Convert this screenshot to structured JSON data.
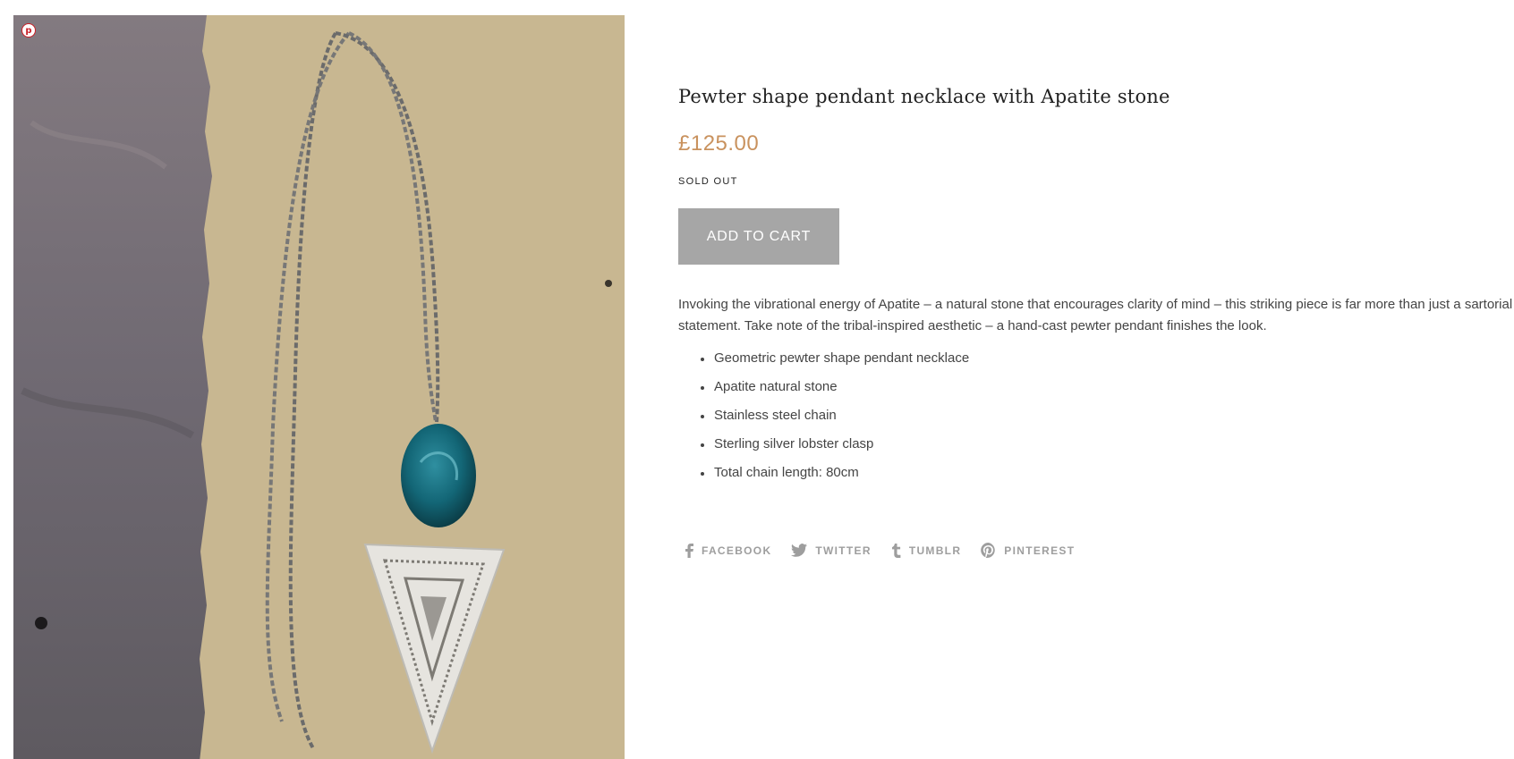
{
  "product": {
    "title": "Pewter shape pendant necklace with Apatite stone",
    "price": "£125.00",
    "stock_status": "SOLD OUT",
    "add_to_cart_label": "ADD TO CART",
    "description": "Invoking the vibrational energy of Apatite – a natural stone that encourages clarity of mind – this striking piece is far more than just a sartorial statement. Take note of the tribal-inspired aesthetic – a hand-cast pewter pendant finishes the look.",
    "features": [
      "Geometric pewter shape pendant necklace",
      "Apatite natural stone",
      "Stainless steel chain",
      "Sterling silver lobster clasp",
      "Total chain length: 80cm"
    ]
  },
  "share": {
    "facebook": "FACEBOOK",
    "twitter": "TWITTER",
    "tumblr": "TUMBLR",
    "pinterest": "PINTEREST"
  },
  "image": {
    "pin_badge_icon": "pinterest-icon",
    "pin_badge_glyph": "p"
  },
  "colors": {
    "price": "#c9925e",
    "button": "#a6a6a6",
    "share": "#9e9e9e",
    "pinterest_red": "#cb2027"
  }
}
